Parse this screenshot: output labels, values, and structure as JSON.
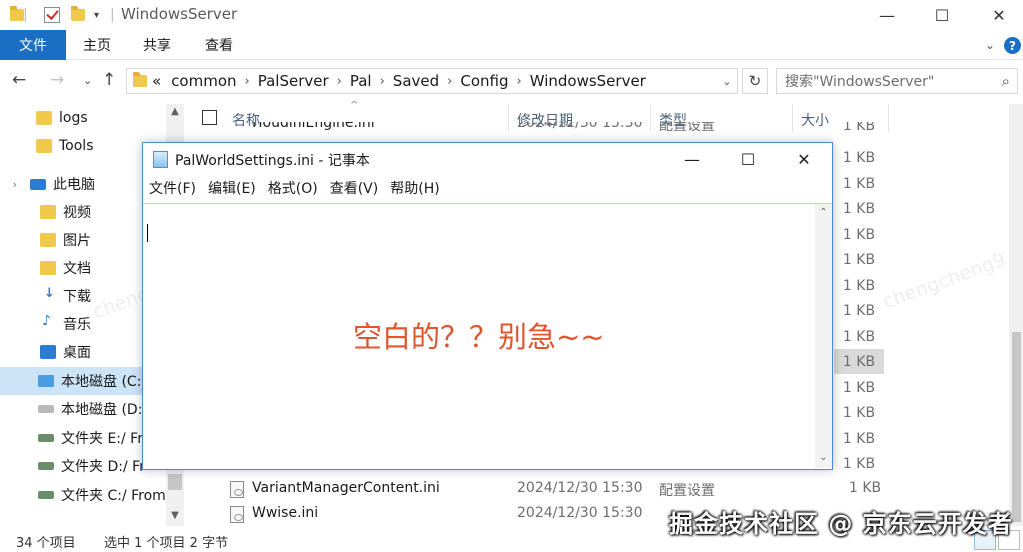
{
  "window": {
    "title": "WindowsServer",
    "min": "—",
    "max": "☐",
    "close": "✕"
  },
  "ribbon": {
    "tabs": [
      "文件",
      "主页",
      "共享",
      "查看"
    ],
    "help": "?"
  },
  "address": {
    "overflow": "«",
    "crumbs": [
      "common",
      "PalServer",
      "Pal",
      "Saved",
      "Config",
      "WindowsServer"
    ],
    "search_placeholder": "搜索\"WindowsServer\""
  },
  "nav_pane": {
    "items": [
      {
        "label": "logs",
        "icon": "folder-icon"
      },
      {
        "label": "Tools",
        "icon": "folder-icon"
      },
      {
        "label": "此电脑",
        "icon": "pc-icon"
      },
      {
        "label": "视频",
        "icon": "video-folder-icon"
      },
      {
        "label": "图片",
        "icon": "pictures-folder-icon"
      },
      {
        "label": "文档",
        "icon": "documents-folder-icon"
      },
      {
        "label": "下载",
        "icon": "downloads-folder-icon"
      },
      {
        "label": "音乐",
        "icon": "music-folder-icon"
      },
      {
        "label": "桌面",
        "icon": "desktop-folder-icon"
      },
      {
        "label": "本地磁盘 (C:)",
        "icon": "windows-drive-icon",
        "selected": true
      },
      {
        "label": "本地磁盘 (D:)",
        "icon": "drive-icon"
      },
      {
        "label": "文件夹 E:/ Fr",
        "icon": "network-drive-icon"
      },
      {
        "label": "文件夹 D:/ Fr",
        "icon": "network-drive-icon"
      },
      {
        "label": "文件夹 C:/ From",
        "icon": "network-drive-icon"
      }
    ]
  },
  "file_list": {
    "columns": [
      "名称",
      "修改日期",
      "类型",
      "大小"
    ],
    "partial_top": {
      "name": "HoudiniEngine.ini",
      "date": "2024/12/30 15:30",
      "type": "配置设置",
      "size": "1 KB"
    },
    "hidden_sizes": [
      "1 KB",
      "1 KB",
      "1 KB",
      "1 KB",
      "1 KB",
      "1 KB",
      "1 KB",
      "1 KB",
      "1 KB",
      "1 KB",
      "1 KB",
      "1 KB",
      "1 KB"
    ],
    "selected_size_index": 8,
    "rows": [
      {
        "name": "VariantManagerContent.ini",
        "date": "2024/12/30 15:30",
        "type": "配置设置",
        "size": "1 KB"
      },
      {
        "name": "Wwise.ini",
        "date": "2024/12/30 15:30",
        "type": "",
        "size": ""
      }
    ]
  },
  "status_bar": {
    "count": "34 个项目",
    "selection": "选中 1 个项目 2 字节"
  },
  "notepad": {
    "title": "PalWorldSettings.ini - 记事本",
    "menu": [
      "文件(F)",
      "编辑(E)",
      "格式(O)",
      "查看(V)",
      "帮助(H)"
    ],
    "content": "",
    "annotation": "空白的？？别急~~"
  },
  "watermarks": {
    "user": "chengcheng9",
    "brand": "掘金技术社区 @ 京东云开发者"
  },
  "colors": {
    "accent": "#1a6fc4",
    "annotation": "#e0552d",
    "selection": "#cce4f7"
  }
}
